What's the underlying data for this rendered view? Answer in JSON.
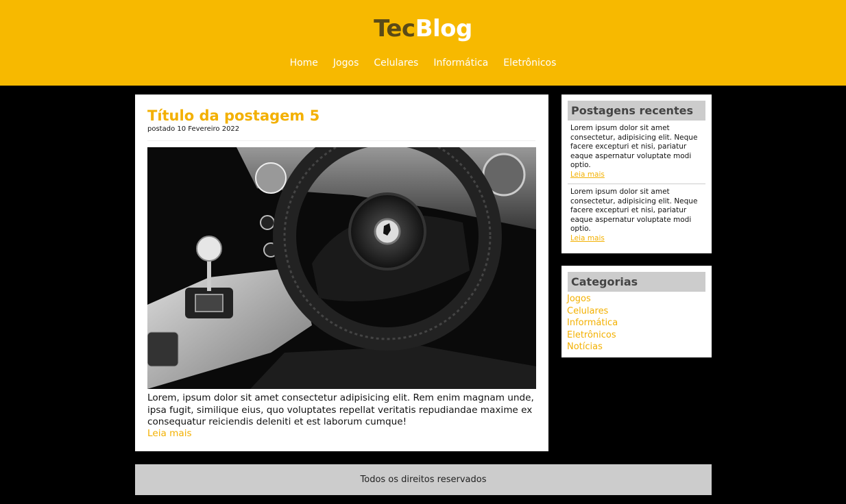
{
  "site": {
    "logo_part1": "Tec",
    "logo_part2": "Blog"
  },
  "nav": [
    "Home",
    "Jogos",
    "Celulares",
    "Informática",
    "Eletrônicos"
  ],
  "post": {
    "title": "Título da postagem 5",
    "date": "postado 10 Fevereiro 2022",
    "text": "Lorem, ipsum dolor sit amet consectetur adipisicing elit. Rem enim magnam unde, ipsa fugit, similique eius, quo voluptates repellat veritatis repudiandae maxime ex consequatur reiciendis deleniti et est laborum cumque!",
    "read_more": "Leia mais"
  },
  "recent": {
    "title": "Postagens recentes",
    "items": [
      {
        "text": "Lorem ipsum dolor sit amet consectetur, adipisicing elit. Neque facere excepturi et nisi, pariatur eaque aspernatur voluptate modi optio.",
        "more": "Leia mais"
      },
      {
        "text": "Lorem ipsum dolor sit amet consectetur, adipisicing elit. Neque facere excepturi et nisi, pariatur eaque aspernatur voluptate modi optio.",
        "more": "Leia mais"
      }
    ]
  },
  "categories": {
    "title": "Categorias",
    "items": [
      "Jogos",
      "Celulares",
      "Informática",
      "Eletrônicos",
      "Notícias"
    ]
  },
  "footer": {
    "text": "Todos os direitos reservados"
  },
  "colors": {
    "accent": "#f7b900",
    "link": "#f3b000",
    "background": "#000000",
    "panel": "#ffffff",
    "widget_header": "#cccccc"
  }
}
